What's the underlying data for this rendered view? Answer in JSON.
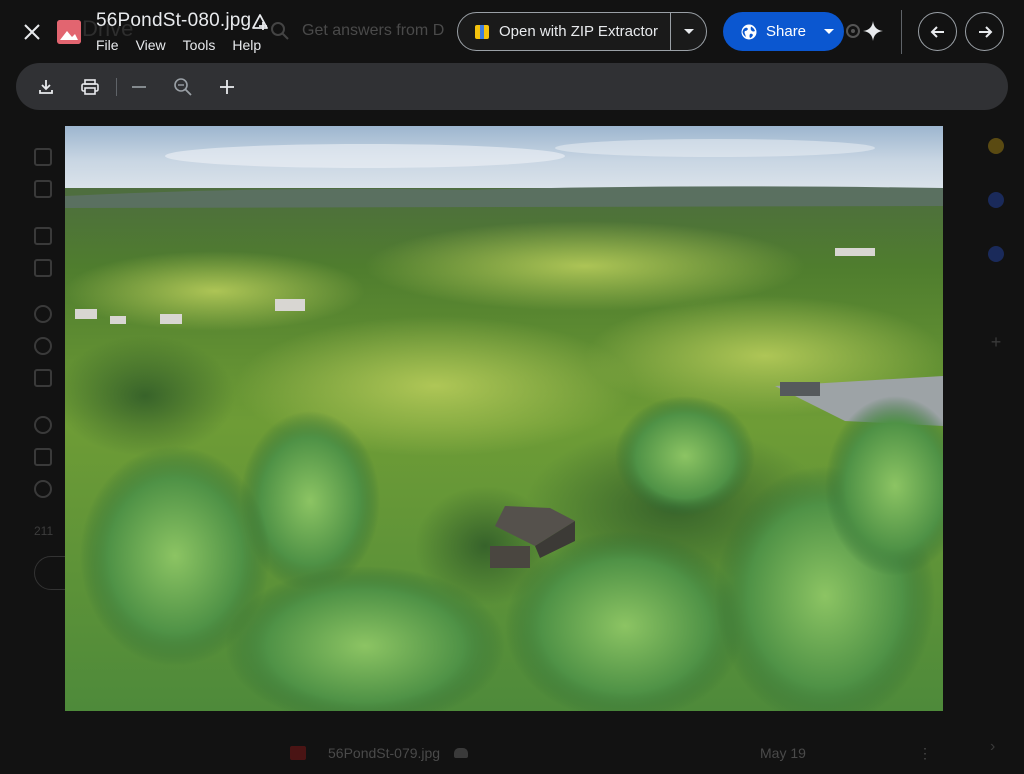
{
  "file": {
    "name": "56PondSt-080.jpg",
    "type_icon": "image-file-icon"
  },
  "menu": {
    "items": [
      "File",
      "Tools",
      "Help"
    ],
    "view": "View"
  },
  "open_with": {
    "label": "Open with ZIP Extractor",
    "app_icon": "zip-extractor-icon"
  },
  "share": {
    "label": "Share",
    "icon": "globe-icon",
    "color": "#0b57d0"
  },
  "toolbar": {
    "buttons": [
      "download-icon",
      "print-icon",
      "zoom-out-icon",
      "zoom-reset-icon",
      "zoom-in-icon"
    ]
  },
  "background": {
    "search_placeholder": "Get answers from D",
    "logo_text": "Drive",
    "storage_text": "211",
    "file_row": {
      "name": "56PondSt-079.jpg",
      "date": "May 19",
      "more": "⋮"
    }
  },
  "image_description_colors": {
    "sky": "#c9d6e3",
    "forest": "#5e8f34",
    "trees_light": "#9cc254"
  }
}
